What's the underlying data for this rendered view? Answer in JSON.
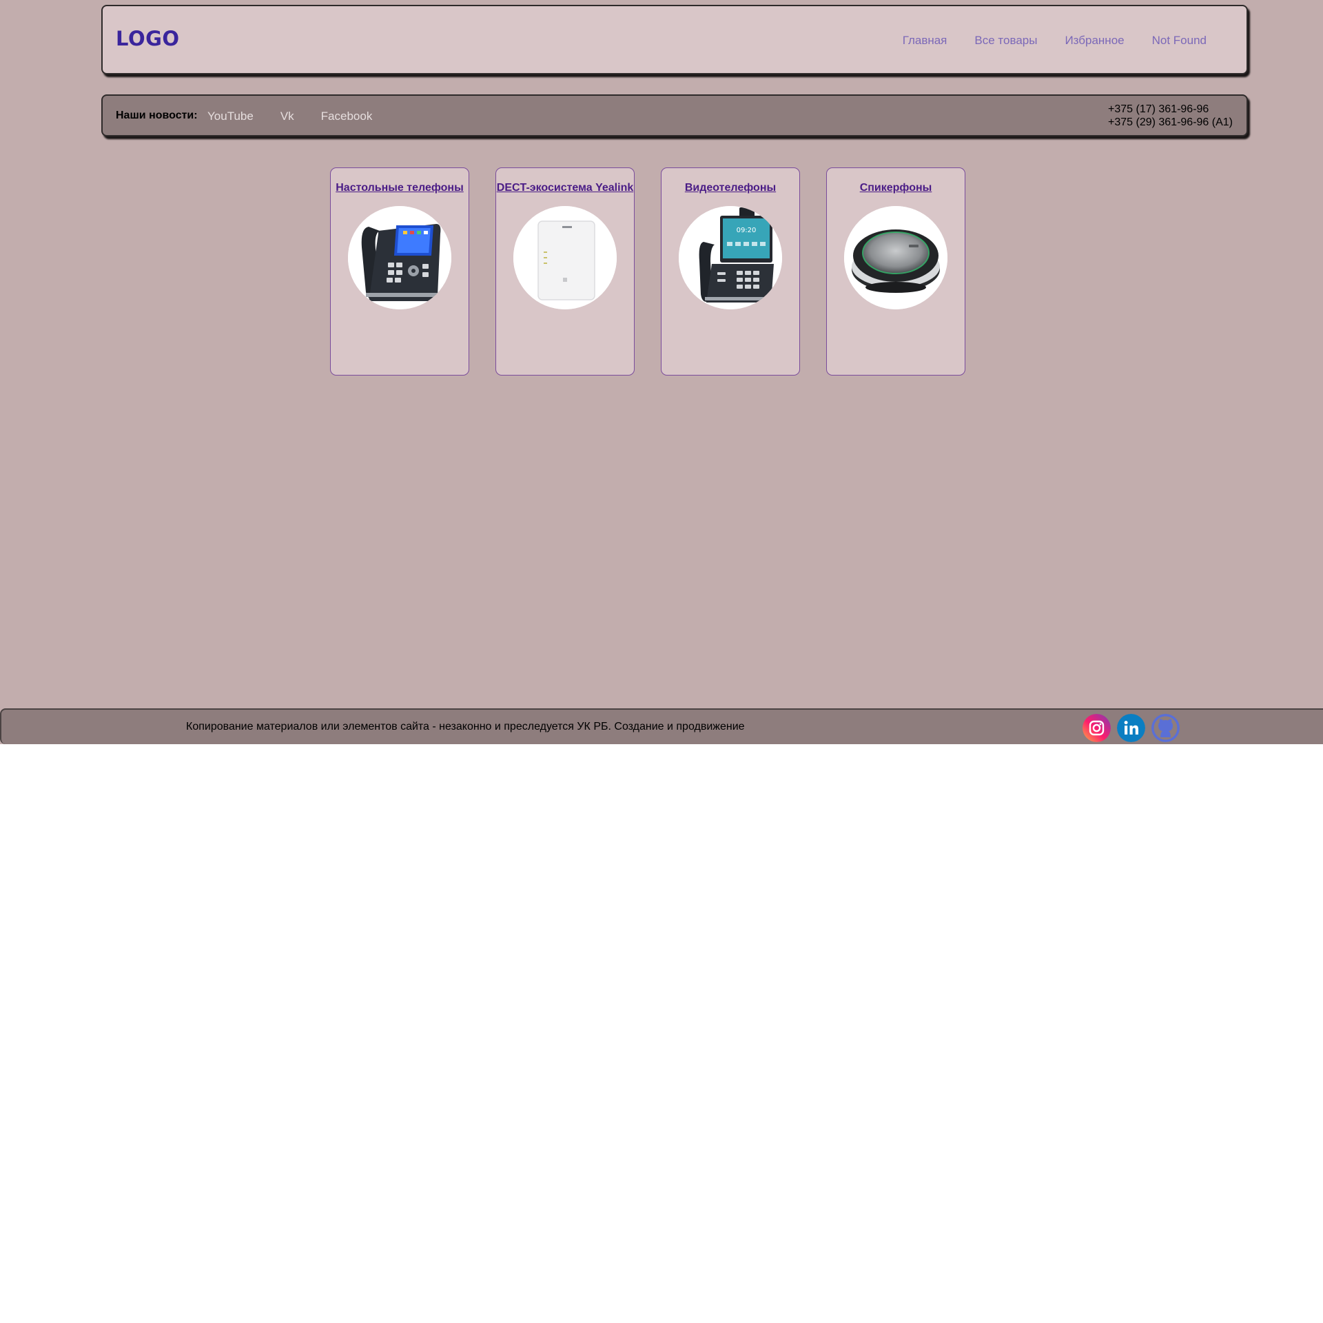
{
  "header": {
    "logo": "LOGO",
    "nav": [
      {
        "label": "Главная"
      },
      {
        "label": "Все товары"
      },
      {
        "label": "Избранное"
      },
      {
        "label": "Not Found"
      }
    ]
  },
  "newsbar": {
    "label": "Наши новости:",
    "links": [
      {
        "label": "YouTube"
      },
      {
        "label": "Vk"
      },
      {
        "label": "Facebook"
      }
    ],
    "phones": [
      "+375 (17) 361-96-96",
      "+375 (29) 361-96-96 (A1)"
    ]
  },
  "categories": [
    {
      "title": "Настольные телефоны",
      "image": "desk-phone-image"
    },
    {
      "title": "DECT-экосистема Yealink",
      "image": "dect-base-station-image"
    },
    {
      "title": "Видеотелефоны",
      "image": "video-phone-image"
    },
    {
      "title": "Спикерфоны",
      "image": "speakerphone-image"
    }
  ],
  "footer": {
    "text": "Копирование материалов или элементов сайта - незаконно и преследуется УК РБ. Создание и продвижение",
    "socials": [
      {
        "icon": "instagram-icon"
      },
      {
        "icon": "linkedin-icon"
      },
      {
        "icon": "github-icon"
      }
    ]
  },
  "colors": {
    "page_background": "#c2adad",
    "header_background": "#d9c6c8",
    "bar_background": "#8e7d7d",
    "logo": "#3a259c",
    "nav_link": "#7b68b8",
    "card_border": "#7a4c9c",
    "card_title": "#4a1c86"
  }
}
